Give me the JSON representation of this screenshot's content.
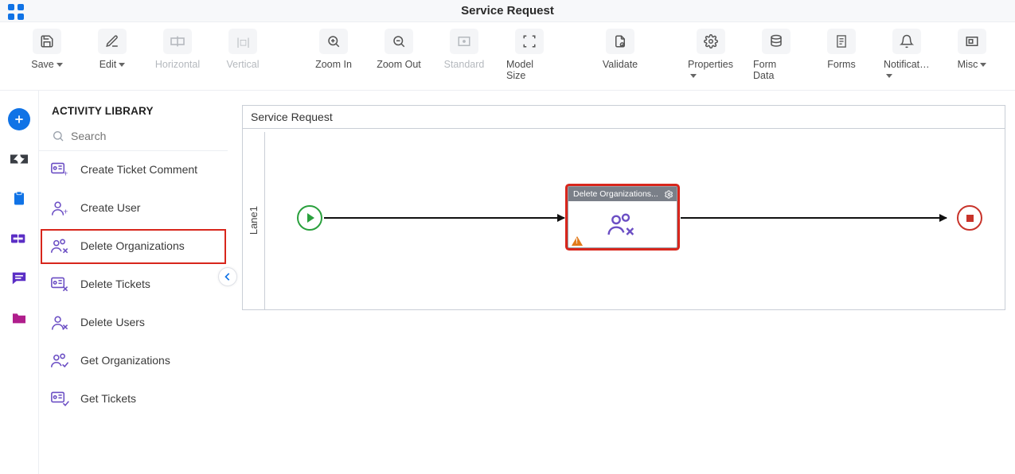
{
  "header": {
    "title": "Service Request"
  },
  "toolbar": {
    "save": "Save",
    "edit": "Edit",
    "horizontal": "Horizontal",
    "vertical": "Vertical",
    "zoom_in": "Zoom In",
    "zoom_out": "Zoom Out",
    "standard": "Standard",
    "model_size": "Model Size",
    "validate": "Validate",
    "properties": "Properties",
    "form_data": "Form Data",
    "forms": "Forms",
    "notifications": "Notificat…",
    "misc": "Misc"
  },
  "sidebar": {
    "heading": "ACTIVITY LIBRARY",
    "search_placeholder": "Search",
    "items": [
      {
        "label": "Create Ticket Comment"
      },
      {
        "label": "Create User"
      },
      {
        "label": "Delete Organizations"
      },
      {
        "label": "Delete Tickets"
      },
      {
        "label": "Delete Users"
      },
      {
        "label": "Get Organizations"
      },
      {
        "label": "Get Tickets"
      }
    ]
  },
  "canvas": {
    "process_name": "Service Request",
    "lane_label": "Lane1",
    "activity_node_title": "Delete Organizations..."
  }
}
